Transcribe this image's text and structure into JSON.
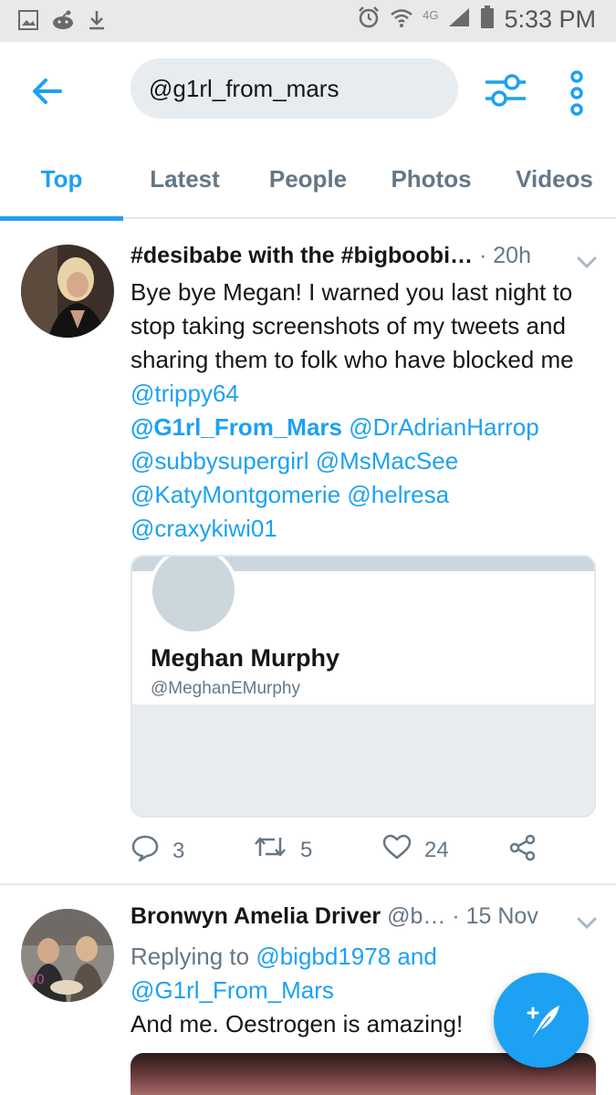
{
  "status_bar": {
    "time": "5:33 PM",
    "network": "4G",
    "icons": [
      "gallery-icon",
      "reddit-icon",
      "download-icon",
      "alarm-icon",
      "wifi-icon",
      "signal-icon",
      "battery-icon"
    ]
  },
  "header": {
    "search_query": "@g1rl_from_mars"
  },
  "tabs": [
    {
      "label": "Top",
      "active": true
    },
    {
      "label": "Latest",
      "active": false
    },
    {
      "label": "People",
      "active": false
    },
    {
      "label": "Photos",
      "active": false
    },
    {
      "label": "Videos",
      "active": false
    }
  ],
  "tweets": [
    {
      "author": "#desibabe with the #bigboobi…",
      "meta": "· 20h",
      "text_plain_1": "Bye bye Megan! I warned you last night to stop taking screenshots of my tweets and sharing them to folk who have blocked me ",
      "mentions": [
        "@trippy64",
        "@G1rl_From_Mars",
        "@DrAdrianHarrop",
        "@subbysupergirl",
        "@MsMacSee",
        "@KatyMontgomerie",
        "@helresa",
        "@craxykiwi01"
      ],
      "card": {
        "name": "Meghan Murphy",
        "handle": "@MeghanEMurphy"
      },
      "replies": "3",
      "retweets": "5",
      "likes": "24"
    },
    {
      "author": "Bronwyn Amelia Driver",
      "meta": "@b… · 15 Nov",
      "replying_prefix": "Replying to ",
      "replying_to_1": "@bigbd1978",
      "replying_and": " and",
      "replying_to_2": "@G1rl_From_Mars",
      "text": "And me. Oestrogen is amazing!"
    }
  ],
  "colors": {
    "accent": "#1da1f2",
    "secondary_text": "#657786",
    "divider": "#e1e8ed"
  }
}
